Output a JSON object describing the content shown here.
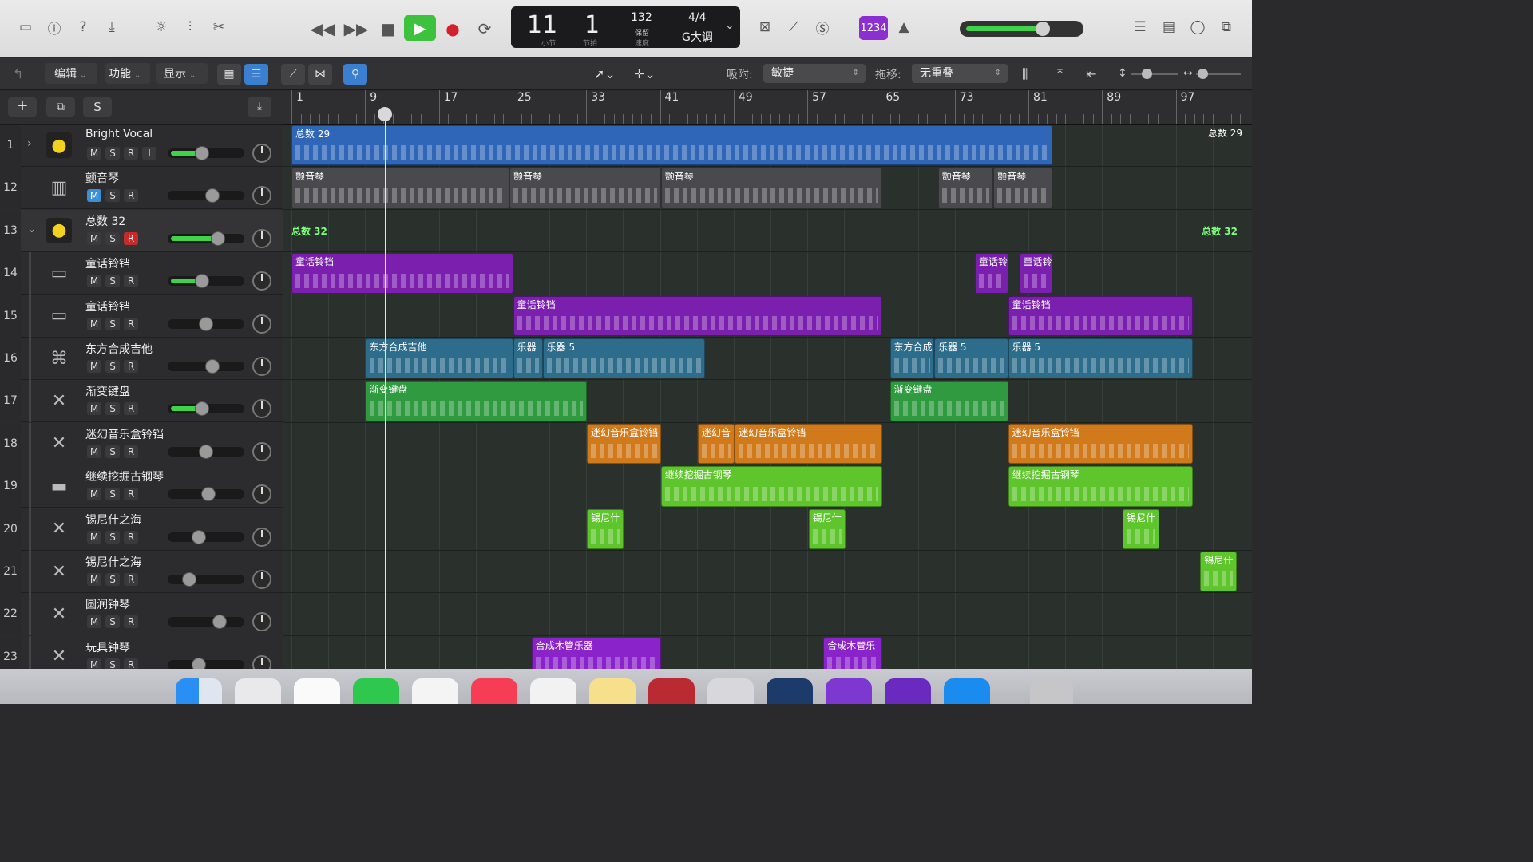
{
  "lcd": {
    "bar": "11",
    "beat": "1",
    "bar_label": "小节",
    "beat_label": "节拍",
    "tempo": "132",
    "tempo_label": "保留",
    "tempo_sub": "速度",
    "signature": "4/4",
    "key": "G大调"
  },
  "toolbar": {
    "count_in": "1234"
  },
  "menus": {
    "edit": "编辑",
    "function": "功能",
    "view": "显示"
  },
  "snap": {
    "label": "吸附:",
    "value": "敏捷"
  },
  "drag": {
    "label": "拖移:",
    "value": "无重叠"
  },
  "header_buttons": {
    "add": "+",
    "solo": "S"
  },
  "ruler": [
    "1",
    "9",
    "17",
    "25",
    "33",
    "41",
    "49",
    "57",
    "65",
    "73",
    "81",
    "89",
    "97"
  ],
  "tracks": [
    {
      "num": "1",
      "name": "Bright Vocal",
      "icon": "vocal-icon",
      "m": "M",
      "s": "S",
      "r": "R",
      "i": "I"
    },
    {
      "num": "12",
      "name": "颤音琴",
      "icon": "vibraphone-icon",
      "m": "M",
      "s": "S",
      "r": "R"
    },
    {
      "num": "13",
      "name": "总数 32",
      "icon": "summing-icon",
      "m": "M",
      "s": "S",
      "r": "R"
    },
    {
      "num": "14",
      "name": "童话铃铛",
      "icon": "keyboard-icon",
      "m": "M",
      "s": "S",
      "r": "R"
    },
    {
      "num": "15",
      "name": "童话铃铛",
      "icon": "keyboard-icon",
      "m": "M",
      "s": "S",
      "r": "R"
    },
    {
      "num": "16",
      "name": "东方合成吉他",
      "icon": "synth-icon",
      "m": "M",
      "s": "S",
      "r": "R"
    },
    {
      "num": "17",
      "name": "渐变键盘",
      "icon": "stand-icon",
      "m": "M",
      "s": "S",
      "r": "R"
    },
    {
      "num": "18",
      "name": "迷幻音乐盒铃铛",
      "icon": "stand-icon",
      "m": "M",
      "s": "S",
      "r": "R"
    },
    {
      "num": "19",
      "name": "继续挖掘古钢琴",
      "icon": "harpsichord-icon",
      "m": "M",
      "s": "S",
      "r": "R"
    },
    {
      "num": "20",
      "name": "锡尼什之海",
      "icon": "stand-icon",
      "m": "M",
      "s": "S",
      "r": "R"
    },
    {
      "num": "21",
      "name": "锡尼什之海",
      "icon": "stand-icon",
      "m": "M",
      "s": "S",
      "r": "R"
    },
    {
      "num": "22",
      "name": "圆润钟琴",
      "icon": "stand-icon",
      "m": "M",
      "s": "S",
      "r": "R"
    },
    {
      "num": "23",
      "name": "玩具钟琴",
      "icon": "stand-icon",
      "m": "M",
      "s": "S",
      "r": "R"
    }
  ],
  "regions": {
    "r1a": "总数 29",
    "r1b": "总数 29",
    "r12a": "颤音琴",
    "r12b": "颤音琴",
    "r12c": "颤音琴",
    "r12d": "颤音琴",
    "r12e": "颤音琴",
    "r13a": "总数 32",
    "r13b": "总数 32",
    "r14a": "童话铃铛",
    "r14b": "童话铃",
    "r14c": "童话铃",
    "r15a": "童话铃铛",
    "r15b": "童话铃铛",
    "r16a": "东方合成吉他",
    "r16b": "乐器",
    "r16c": "乐器 5",
    "r16d": "东方合成",
    "r16e": "乐器 5",
    "r16f": "乐器 5",
    "r17a": "渐变键盘",
    "r17b": "渐变键盘",
    "r18a": "迷幻音乐盒铃铛",
    "r18b": "迷幻音",
    "r18c": "迷幻音乐盒铃铛",
    "r18d": "迷幻音乐盒铃铛",
    "r19a": "继续挖掘古钢琴",
    "r19b": "继续挖掘古钢琴",
    "r20a": "锡尼什",
    "r20b": "锡尼什",
    "r20c": "锡尼什",
    "r21a": "锡尼什",
    "r23a": "合成木管乐器",
    "r23b": "合成木管乐"
  },
  "colors": {
    "blue": "#2f66b8",
    "gray": "#4a4a4e",
    "purple": "#7a1fae",
    "teal": "#2d6c8a",
    "green": "#2f9a3f",
    "orange": "#d17a1c",
    "lime": "#5ec62c",
    "violet": "#8a23c9"
  }
}
